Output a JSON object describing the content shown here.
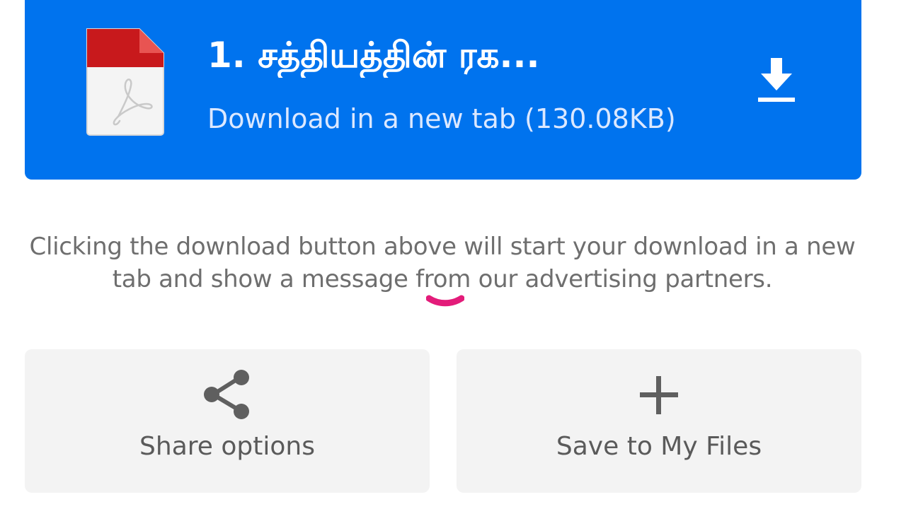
{
  "download_card": {
    "file_title": "1. சத்தியத்தின் ரக...",
    "subtitle": "Download in a new tab (130.08KB)",
    "file_icon": "pdf-file-icon",
    "action_icon": "download-icon",
    "background_color": "#0073ee"
  },
  "notice": {
    "text": "Clicking the download button above will start your download in a new tab and show a message from our advertising partners."
  },
  "actions": {
    "share": {
      "label": "Share options",
      "icon": "share-icon"
    },
    "save": {
      "label": "Save to My Files",
      "icon": "plus-icon"
    }
  }
}
